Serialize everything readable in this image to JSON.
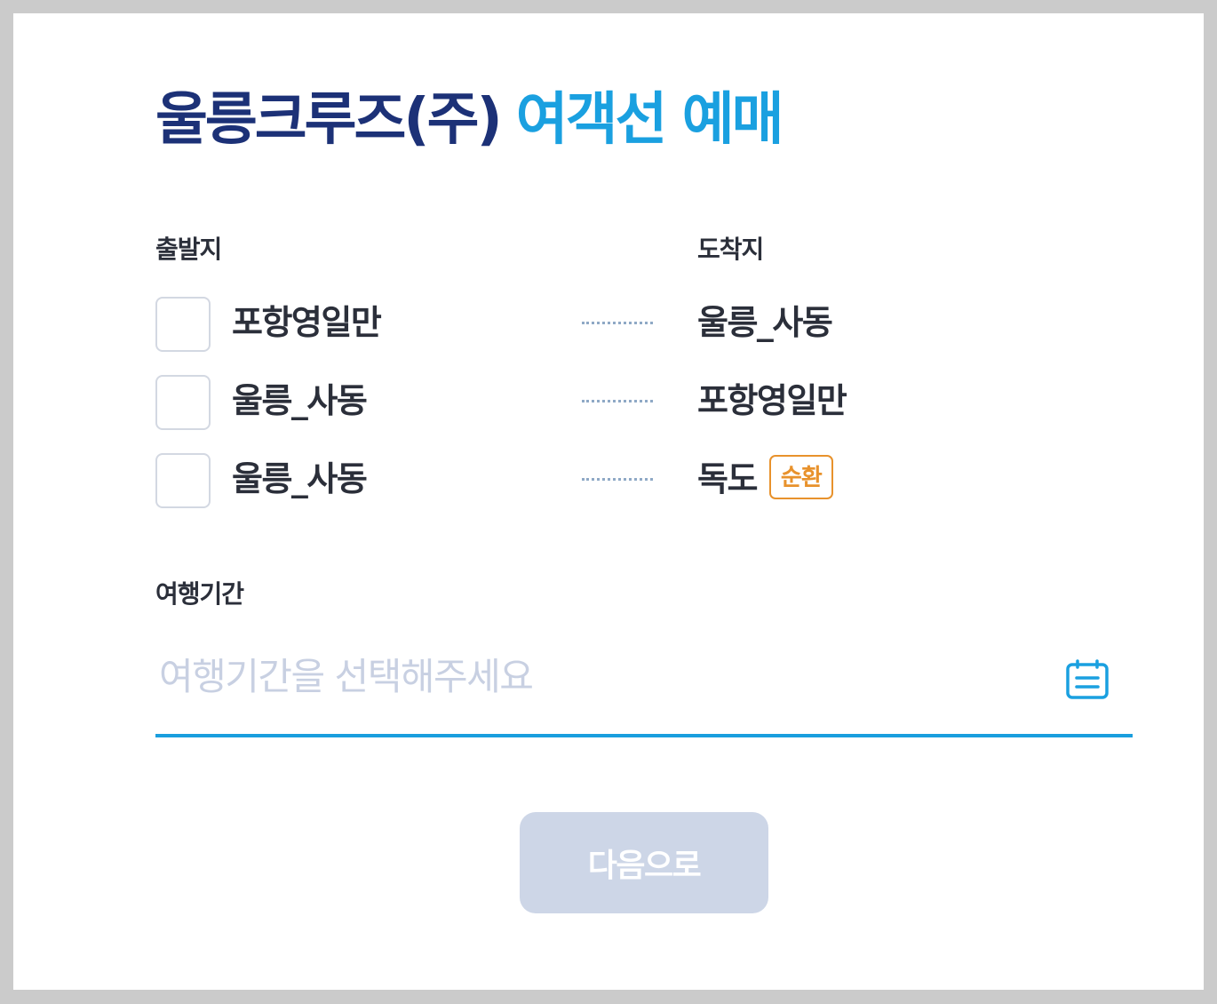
{
  "header": {
    "brand": "울릉크루즈(주)",
    "service": "여객선 예매"
  },
  "labels": {
    "departure": "출발지",
    "arrival": "도착지",
    "period": "여행기간"
  },
  "routes": [
    {
      "from": "포항영일만",
      "to": "울릉_사동",
      "badge": ""
    },
    {
      "from": "울릉_사동",
      "to": "포항영일만",
      "badge": ""
    },
    {
      "from": "울릉_사동",
      "to": "독도",
      "badge": "순환"
    }
  ],
  "period": {
    "placeholder": "여행기간을 선택해주세요"
  },
  "next_button": {
    "label": "다음으로"
  },
  "colors": {
    "brand": "#1c3177",
    "accent": "#1aa0e0",
    "badge": "#e8922c",
    "button_disabled": "#cdd6e7"
  },
  "icons": {
    "calendar": "calendar-icon"
  }
}
